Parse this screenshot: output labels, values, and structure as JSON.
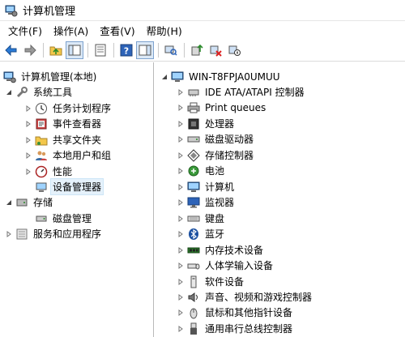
{
  "window": {
    "title": "计算机管理"
  },
  "menu": [
    "文件(F)",
    "操作(A)",
    "查看(V)",
    "帮助(H)"
  ],
  "left_tree": {
    "root": "计算机管理(本地)",
    "system_tools": "系统工具",
    "system_children": [
      "任务计划程序",
      "事件查看器",
      "共享文件夹",
      "本地用户和组",
      "性能",
      "设备管理器"
    ],
    "storage": "存储",
    "disk_management": "磁盘管理",
    "services": "服务和应用程序"
  },
  "right_tree": {
    "computer_name": "WIN-T8FPJA0UMUU",
    "categories": [
      "IDE ATA/ATAPI 控制器",
      "Print queues",
      "处理器",
      "磁盘驱动器",
      "存储控制器",
      "电池",
      "计算机",
      "监视器",
      "键盘",
      "蓝牙",
      "内存技术设备",
      "人体学输入设备",
      "软件设备",
      "声音、视频和游戏控制器",
      "鼠标和其他指针设备",
      "通用串行总线控制器"
    ]
  }
}
